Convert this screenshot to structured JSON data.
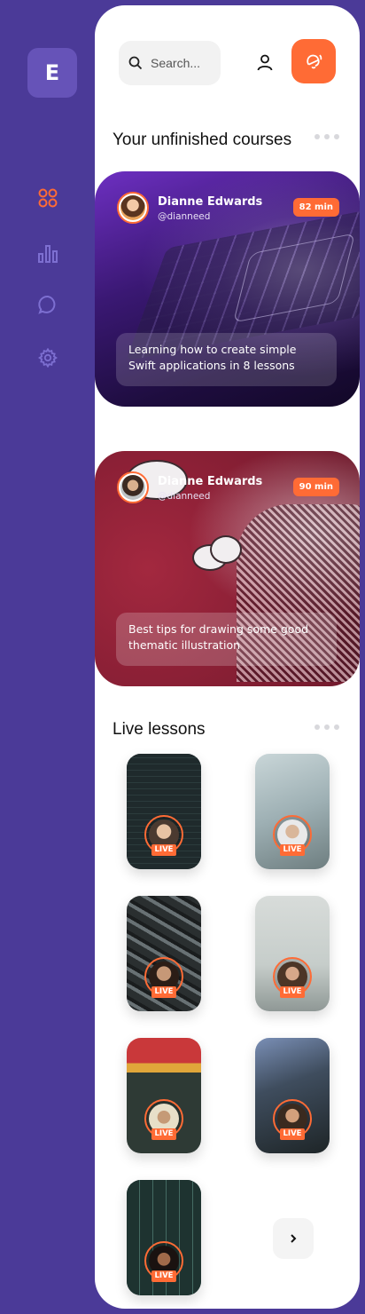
{
  "sidebar": {
    "logo_letter": "E",
    "items": [
      {
        "icon": "grid-icon",
        "active": true
      },
      {
        "icon": "chart-icon",
        "active": false
      },
      {
        "icon": "chat-icon",
        "active": false
      },
      {
        "icon": "gear-icon",
        "active": false
      }
    ]
  },
  "colors": {
    "accent": "#ff6b35",
    "sidebar_bg": "#4b3a98",
    "icon_inactive": "#7d6fd1"
  },
  "header": {
    "search_placeholder": "Search...",
    "profile_icon": "user-icon",
    "notification_icon": "bell-icon"
  },
  "unfinished": {
    "title": "Your unfinished courses",
    "courses": [
      {
        "author": "Dianne Edwards",
        "handle": "@dianneed",
        "duration": "82 min",
        "description": "Learning how to create simple Swift applications in 8 lessons"
      },
      {
        "author": "Dianne Edwards",
        "handle": "@dianneed",
        "duration": "90 min",
        "description": "Best tips for drawing some good thematic illustration"
      }
    ]
  },
  "live": {
    "title": "Live lessons",
    "badge": "LIVE",
    "lessons": [
      {
        "badge": "LIVE"
      },
      {
        "badge": "LIVE"
      },
      {
        "badge": "LIVE"
      },
      {
        "badge": "LIVE"
      },
      {
        "badge": "LIVE"
      },
      {
        "badge": "LIVE"
      },
      {
        "badge": "LIVE"
      }
    ],
    "next_icon": "chevron-right-icon"
  }
}
